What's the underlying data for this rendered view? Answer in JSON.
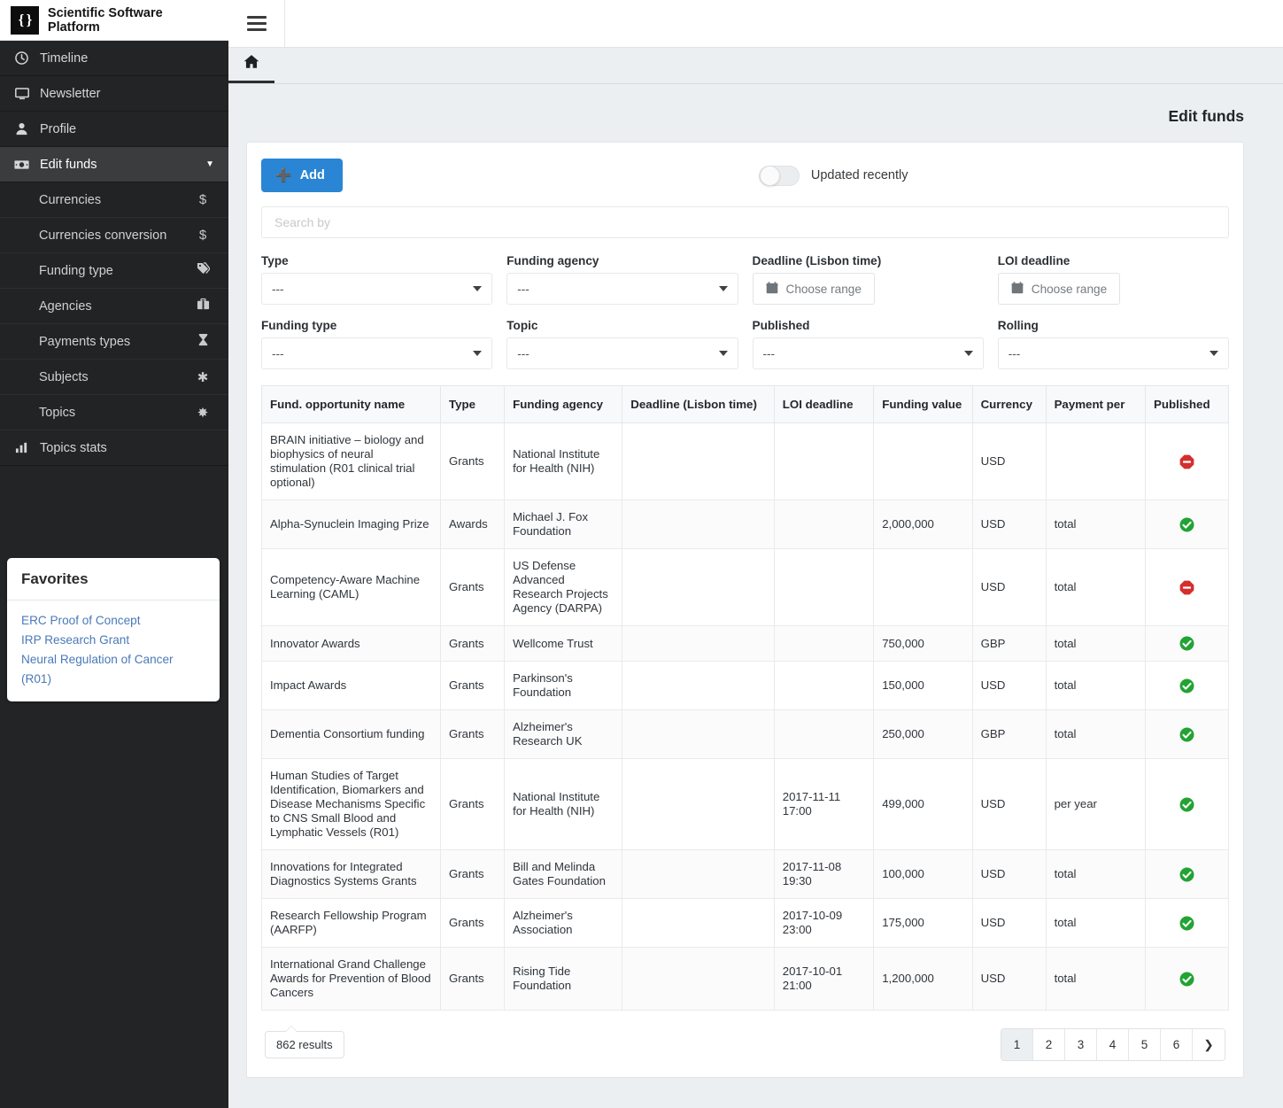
{
  "brand": {
    "logo": "{ }",
    "title": "Scientific Software Platform"
  },
  "sidebar": {
    "items": [
      {
        "label": "Timeline",
        "icon": "clock-icon"
      },
      {
        "label": "Newsletter",
        "icon": "monitor-icon"
      },
      {
        "label": "Profile",
        "icon": "user-icon"
      },
      {
        "label": "Edit funds",
        "icon": "money-bill-icon",
        "active": true
      }
    ],
    "subitems": [
      {
        "label": "Currencies",
        "icon": "dollar-icon",
        "glyph": "$"
      },
      {
        "label": "Currencies conversion",
        "icon": "dollar-icon",
        "glyph": "$"
      },
      {
        "label": "Funding type",
        "icon": "tags-icon",
        "glyph": "🏷"
      },
      {
        "label": "Agencies",
        "icon": "briefcase-icon",
        "glyph": "💼"
      },
      {
        "label": "Payments types",
        "icon": "hourglass-icon",
        "glyph": "⌛"
      },
      {
        "label": "Subjects",
        "icon": "asterisk-icon",
        "glyph": "✱"
      },
      {
        "label": "Topics",
        "icon": "certificate-icon",
        "glyph": "✸"
      }
    ],
    "stats": {
      "label": "Topics stats",
      "icon": "bar-chart-icon"
    },
    "favorites": {
      "title": "Favorites",
      "links": [
        "ERC Proof of Concept",
        "IRP Research Grant",
        "Neural Regulation of Cancer (R01)"
      ]
    }
  },
  "topbar": {
    "menu_icon": "hamburger-icon",
    "home_tab_icon": "home-icon"
  },
  "page": {
    "title": "Edit funds"
  },
  "toolbar": {
    "add_label": "Add",
    "add_icon": "plus-icon",
    "toggle_label": "Updated recently",
    "toggle_on": false
  },
  "search": {
    "value": "",
    "placeholder": "Search by"
  },
  "filters": [
    {
      "label": "Type",
      "value": "---",
      "kind": "select"
    },
    {
      "label": "Funding agency",
      "value": "---",
      "kind": "select"
    },
    {
      "label": "Deadline (Lisbon time)",
      "value": "Choose range",
      "kind": "daterange"
    },
    {
      "label": "LOI deadline",
      "value": "Choose range",
      "kind": "daterange"
    },
    {
      "label": "Funding type",
      "value": "---",
      "kind": "select"
    },
    {
      "label": "Topic",
      "value": "---",
      "kind": "select"
    },
    {
      "label": "Published",
      "value": "---",
      "kind": "select"
    },
    {
      "label": "Rolling",
      "value": "---",
      "kind": "select"
    }
  ],
  "table": {
    "columns": [
      "Fund. opportunity name",
      "Type",
      "Funding agency",
      "Deadline (Lisbon time)",
      "LOI deadline",
      "Funding value",
      "Currency",
      "Payment per",
      "Published"
    ],
    "rows": [
      {
        "name": "BRAIN initiative – biology and biophysics of neural stimulation (R01 clinical trial optional)",
        "type": "Grants",
        "agency": "National Institute for Health (NIH)",
        "deadline": "",
        "loi_deadline": "",
        "funding_value": "",
        "currency": "USD",
        "payment_per": "",
        "published": "no"
      },
      {
        "name": "Alpha-Synuclein Imaging Prize",
        "type": "Awards",
        "agency": "Michael J. Fox Foundation",
        "deadline": "",
        "loi_deadline": "",
        "funding_value": "2,000,000",
        "currency": "USD",
        "payment_per": "total",
        "published": "yes"
      },
      {
        "name": "Competency-Aware Machine Learning (CAML)",
        "type": "Grants",
        "agency": "US Defense Advanced Research Projects Agency (DARPA)",
        "deadline": "",
        "loi_deadline": "",
        "funding_value": "",
        "currency": "USD",
        "payment_per": "total",
        "published": "no"
      },
      {
        "name": "Innovator Awards",
        "type": "Grants",
        "agency": "Wellcome Trust",
        "deadline": "",
        "loi_deadline": "",
        "funding_value": "750,000",
        "currency": "GBP",
        "payment_per": "total",
        "published": "yes"
      },
      {
        "name": "Impact Awards",
        "type": "Grants",
        "agency": "Parkinson's Foundation",
        "deadline": "",
        "loi_deadline": "",
        "funding_value": "150,000",
        "currency": "USD",
        "payment_per": "total",
        "published": "yes"
      },
      {
        "name": "Dementia Consortium funding",
        "type": "Grants",
        "agency": "Alzheimer's Research UK",
        "deadline": "",
        "loi_deadline": "",
        "funding_value": "250,000",
        "currency": "GBP",
        "payment_per": "total",
        "published": "yes"
      },
      {
        "name": "Human Studies of Target Identification, Biomarkers and Disease Mechanisms Specific to CNS Small Blood and Lymphatic Vessels (R01)",
        "type": "Grants",
        "agency": "National Institute for Health (NIH)",
        "deadline": "",
        "loi_deadline": "2017-11-11 17:00",
        "funding_value": "499,000",
        "currency": "USD",
        "payment_per": "per year",
        "published": "yes"
      },
      {
        "name": "Innovations for Integrated Diagnostics Systems Grants",
        "type": "Grants",
        "agency": "Bill and Melinda Gates Foundation",
        "deadline": "",
        "loi_deadline": "2017-11-08 19:30",
        "funding_value": "100,000",
        "currency": "USD",
        "payment_per": "total",
        "published": "yes"
      },
      {
        "name": "Research Fellowship Program (AARFP)",
        "type": "Grants",
        "agency": "Alzheimer's Association",
        "deadline": "",
        "loi_deadline": "2017-10-09 23:00",
        "funding_value": "175,000",
        "currency": "USD",
        "payment_per": "total",
        "published": "yes"
      },
      {
        "name": "International Grand Challenge Awards for Prevention of Blood Cancers",
        "type": "Grants",
        "agency": "Rising Tide Foundation",
        "deadline": "",
        "loi_deadline": "2017-10-01 21:00",
        "funding_value": "1,200,000",
        "currency": "USD",
        "payment_per": "total",
        "published": "yes"
      }
    ]
  },
  "footer": {
    "results_label": "862 results",
    "pages": [
      "1",
      "2",
      "3",
      "4",
      "5",
      "6"
    ],
    "active_page": "1",
    "next_icon": "chevron-right-icon",
    "next_glyph": "❯"
  },
  "colors": {
    "accent": "#2a86d4",
    "sidebar_bg": "#222426",
    "published_yes": "#22a333",
    "published_no": "#d32f2f",
    "page_bg": "#eceff1"
  }
}
